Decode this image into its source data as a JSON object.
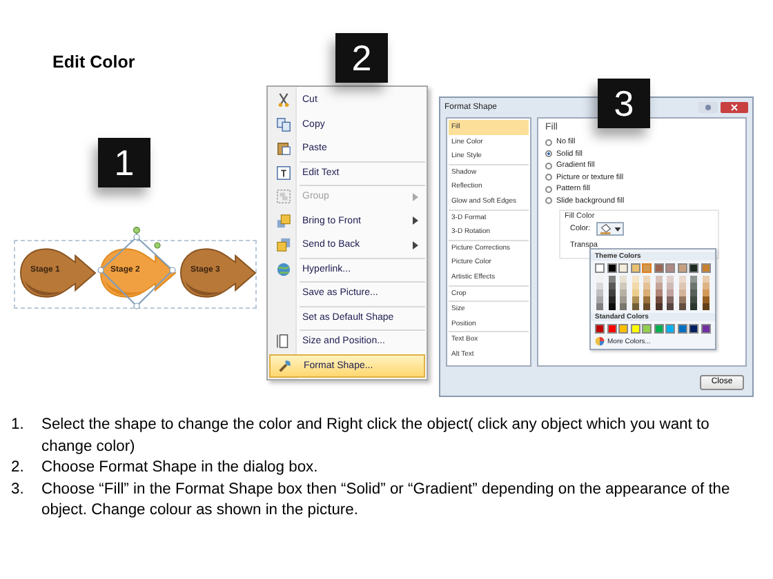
{
  "title": "Edit Color",
  "shapes_panel": {
    "badge": "1",
    "stages": [
      {
        "label": "Stage 1",
        "selected": false
      },
      {
        "label": "Stage 2",
        "selected": true
      },
      {
        "label": "Stage 3",
        "selected": false
      }
    ]
  },
  "context_menu": {
    "badge": "2",
    "items": [
      {
        "label": "Cut",
        "disabled": false,
        "submenu": false,
        "separator_before": false,
        "selected": false
      },
      {
        "label": "Copy",
        "disabled": false,
        "submenu": false,
        "separator_before": false,
        "selected": false
      },
      {
        "label": "Paste",
        "disabled": false,
        "submenu": false,
        "separator_before": false,
        "selected": false
      },
      {
        "label": "Edit Text",
        "disabled": false,
        "submenu": false,
        "separator_before": true,
        "selected": false
      },
      {
        "label": "Group",
        "disabled": true,
        "submenu": true,
        "separator_before": true,
        "selected": false
      },
      {
        "label": "Bring to Front",
        "disabled": false,
        "submenu": true,
        "separator_before": false,
        "selected": false
      },
      {
        "label": "Send to Back",
        "disabled": false,
        "submenu": true,
        "separator_before": false,
        "selected": false
      },
      {
        "label": "Hyperlink...",
        "disabled": false,
        "submenu": false,
        "separator_before": true,
        "selected": false
      },
      {
        "label": "Save as Picture...",
        "disabled": false,
        "submenu": false,
        "separator_before": true,
        "selected": false
      },
      {
        "label": "Set as Default Shape",
        "disabled": false,
        "submenu": false,
        "separator_before": true,
        "selected": false
      },
      {
        "label": "Size and Position...",
        "disabled": false,
        "submenu": false,
        "separator_before": true,
        "selected": false
      },
      {
        "label": "Format Shape...",
        "disabled": false,
        "submenu": false,
        "separator_before": false,
        "selected": true
      }
    ]
  },
  "format_dialog": {
    "badge": "3",
    "title": "Format Shape",
    "sidebar": [
      {
        "label": "Fill",
        "selected": true,
        "separator_before": false
      },
      {
        "label": "Line Color",
        "selected": false,
        "separator_before": false
      },
      {
        "label": "Line Style",
        "selected": false,
        "separator_before": false
      },
      {
        "label": "Shadow",
        "selected": false,
        "separator_before": true
      },
      {
        "label": "Reflection",
        "selected": false,
        "separator_before": false
      },
      {
        "label": "Glow and Soft Edges",
        "selected": false,
        "separator_before": false
      },
      {
        "label": "3-D Format",
        "selected": false,
        "separator_before": true
      },
      {
        "label": "3-D Rotation",
        "selected": false,
        "separator_before": false
      },
      {
        "label": "Picture Corrections",
        "selected": false,
        "separator_before": true
      },
      {
        "label": "Picture Color",
        "selected": false,
        "separator_before": false
      },
      {
        "label": "Artistic Effects",
        "selected": false,
        "separator_before": false
      },
      {
        "label": "Crop",
        "selected": false,
        "separator_before": true
      },
      {
        "label": "Size",
        "selected": false,
        "separator_before": true
      },
      {
        "label": "Position",
        "selected": false,
        "separator_before": false
      },
      {
        "label": "Text Box",
        "selected": false,
        "separator_before": true
      },
      {
        "label": "Alt Text",
        "selected": false,
        "separator_before": false
      }
    ],
    "heading": "Fill",
    "fill_options": [
      {
        "label": "No fill",
        "selected": false
      },
      {
        "label": "Solid fill",
        "selected": true
      },
      {
        "label": "Gradient fill",
        "selected": false
      },
      {
        "label": "Picture or texture fill",
        "selected": false
      },
      {
        "label": "Pattern fill",
        "selected": false
      },
      {
        "label": "Slide background fill",
        "selected": false
      }
    ],
    "fill_color_group": "Fill Color",
    "color_label": "Color:",
    "transparency_label": "Transpa",
    "palette": {
      "theme_heading": "Theme Colors",
      "theme_colors": [
        {
          "color": "#ffffff",
          "selected": false
        },
        {
          "color": "#000000",
          "selected": false
        },
        {
          "color": "#f4ecdc",
          "selected": false
        },
        {
          "color": "#e8c070",
          "selected": false
        },
        {
          "color": "#d09850",
          "selected": true
        },
        {
          "color": "#9c6654",
          "selected": false
        },
        {
          "color": "#b08a84",
          "selected": false
        },
        {
          "color": "#c8a080",
          "selected": false
        },
        {
          "color": "#1e2a22",
          "selected": false
        },
        {
          "color": "#c88030",
          "selected": false
        }
      ],
      "standard_heading": "Standard Colors",
      "standard_colors": [
        {
          "color": "#c00000"
        },
        {
          "color": "#ff0000"
        },
        {
          "color": "#ffc000"
        },
        {
          "color": "#ffff00"
        },
        {
          "color": "#92d050"
        },
        {
          "color": "#00b050"
        },
        {
          "color": "#00b0f0"
        },
        {
          "color": "#0070c0"
        },
        {
          "color": "#002060"
        },
        {
          "color": "#7030a0"
        }
      ],
      "more_colors": "More Colors..."
    },
    "close_button": "Close"
  },
  "instructions": [
    {
      "number": "1.",
      "text": "Select the shape to change the color and Right click the object( click any object which you want to change color)"
    },
    {
      "number": "2.",
      "text": "Choose Format Shape in the dialog box."
    },
    {
      "number": "3.",
      "text": "Choose “Fill” in the Format Shape box then “Solid” or “Gradient” depending on the appearance of the object. Change colour as shown in the picture."
    }
  ]
}
